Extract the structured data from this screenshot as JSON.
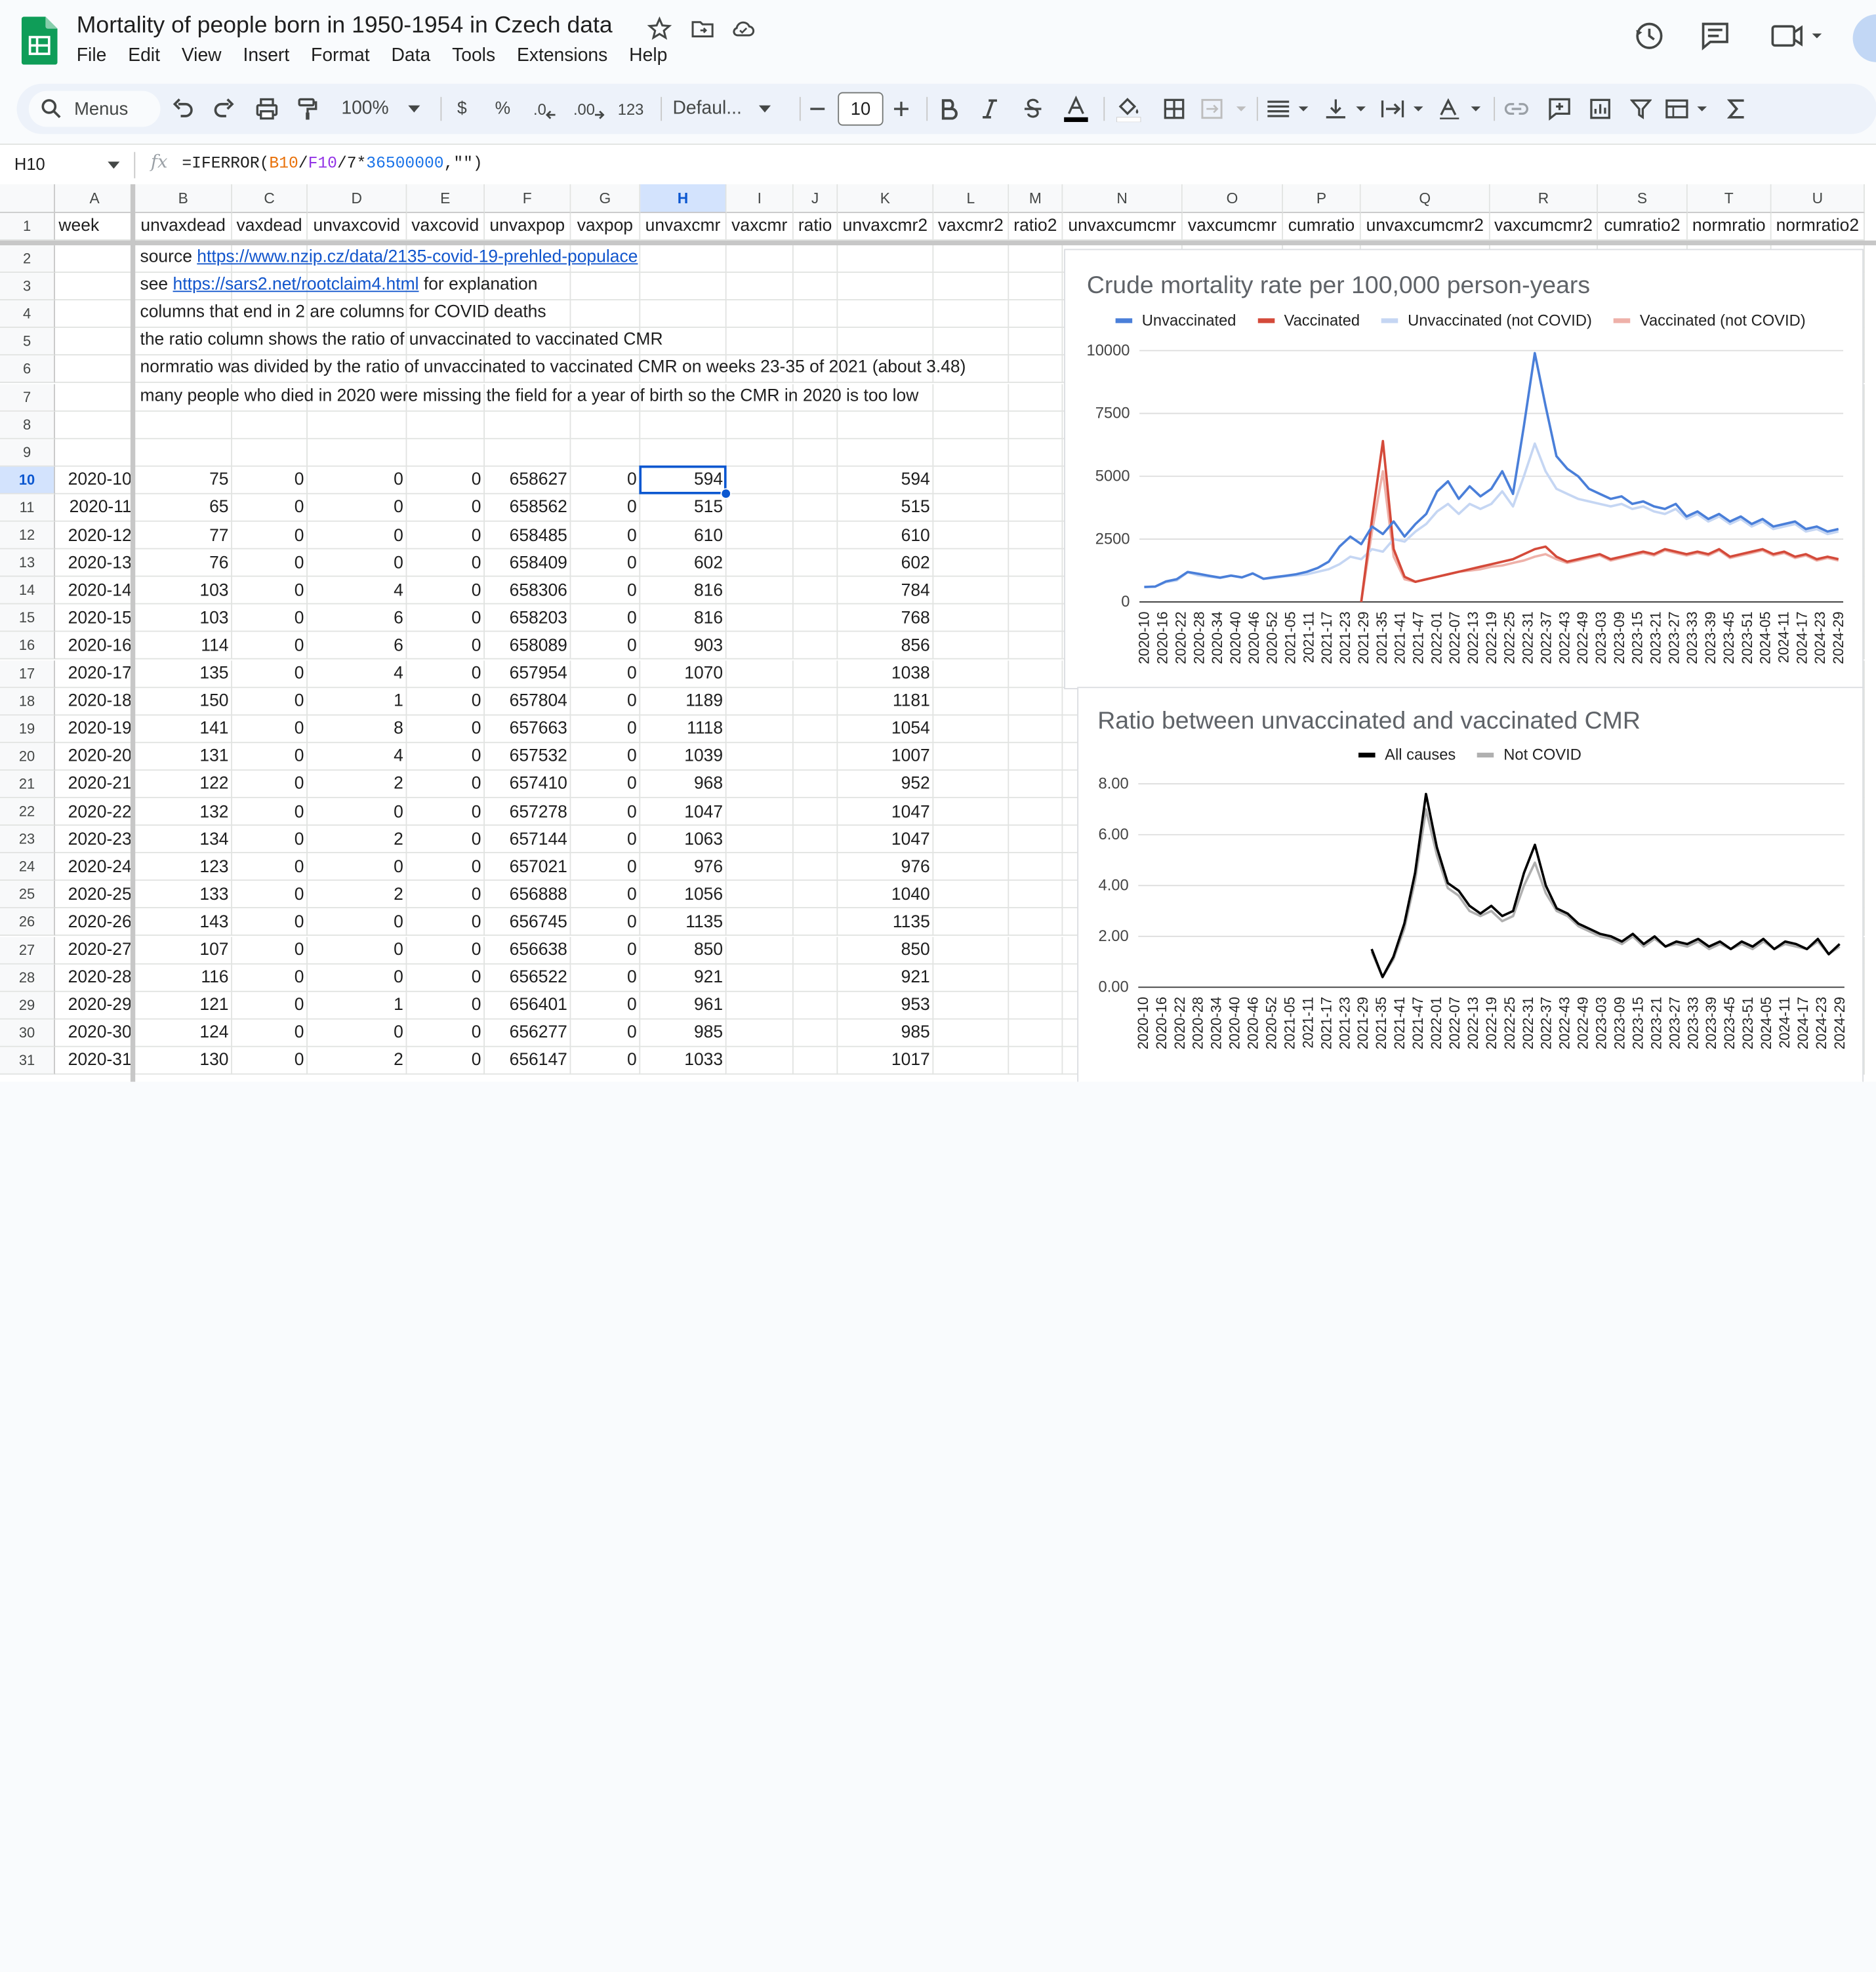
{
  "app": {
    "doc_title": "Mortality of people born in 1950-1954 in Czech data",
    "menu": [
      "File",
      "Edit",
      "View",
      "Insert",
      "Format",
      "Data",
      "Tools",
      "Extensions",
      "Help"
    ],
    "colors": {
      "sheets_green": "#0f9d58",
      "selection": "#0b57d0"
    }
  },
  "toolbar": {
    "menus_label": "Menus",
    "zoom": "100%",
    "currency": "$",
    "percent": "%",
    "dec_decrease": ".0",
    "dec_increase": ".00",
    "number_format": "123",
    "font": "Defaul...",
    "font_size": "10"
  },
  "formula_bar": {
    "cell_ref": "H10",
    "fx": "fx",
    "formula_parts": [
      "=IFERROR(",
      "B10",
      "/",
      "F10",
      "/7*",
      "36500000",
      ",\"\")"
    ]
  },
  "columns": [
    "A",
    "B",
    "C",
    "D",
    "E",
    "F",
    "G",
    "H",
    "I",
    "J",
    "K",
    "L",
    "M",
    "N",
    "O",
    "P",
    "Q",
    "R",
    "S",
    "T",
    "U"
  ],
  "header_row": [
    "week",
    "unvaxdead",
    "vaxdead",
    "unvaxcovid",
    "vaxcovid",
    "unvaxpop",
    "vaxpop",
    "unvaxcmr",
    "vaxcmr",
    "ratio",
    "unvaxcmr2",
    "vaxcmr2",
    "ratio2",
    "unvaxcumcmr",
    "vaxcumcmr",
    "cumratio",
    "unvaxcumcmr2",
    "vaxcumcmr2",
    "cumratio2",
    "normratio",
    "normratio2"
  ],
  "row_numbers": [
    "1",
    "2",
    "3",
    "4",
    "5",
    "6",
    "7",
    "8",
    "9",
    "10",
    "11",
    "12",
    "13",
    "14",
    "15",
    "16",
    "17",
    "18",
    "19",
    "20",
    "21",
    "22",
    "23",
    "24",
    "25",
    "26",
    "27",
    "28",
    "29",
    "30",
    "31"
  ],
  "notes": {
    "source_prefix": "source ",
    "source_link": "https://www.nzip.cz/data/2135-covid-19-prehled-populace",
    "see_prefix": "see ",
    "see_link": "https://sars2.net/rootclaim4.html",
    "see_suffix": " for explanation",
    "line3": "columns that end in 2 are columns for COVID deaths",
    "line4": "the ratio column shows the ratio of unvaccinated to vaccinated CMR",
    "line5": "normratio was divided by the ratio of unvaccinated to vaccinated CMR on weeks 23-35 of 2021 (about 3.48)",
    "line6": "many people who died in 2020 were missing the field for a year of birth so the CMR in 2020 is too low"
  },
  "data_rows": [
    [
      "2020-10",
      "75",
      "0",
      "0",
      "0",
      "658627",
      "0",
      "594",
      "594"
    ],
    [
      "2020-11",
      "65",
      "0",
      "0",
      "0",
      "658562",
      "0",
      "515",
      "515"
    ],
    [
      "2020-12",
      "77",
      "0",
      "0",
      "0",
      "658485",
      "0",
      "610",
      "610"
    ],
    [
      "2020-13",
      "76",
      "0",
      "0",
      "0",
      "658409",
      "0",
      "602",
      "602"
    ],
    [
      "2020-14",
      "103",
      "0",
      "4",
      "0",
      "658306",
      "0",
      "816",
      "784"
    ],
    [
      "2020-15",
      "103",
      "0",
      "6",
      "0",
      "658203",
      "0",
      "816",
      "768"
    ],
    [
      "2020-16",
      "114",
      "0",
      "6",
      "0",
      "658089",
      "0",
      "903",
      "856"
    ],
    [
      "2020-17",
      "135",
      "0",
      "4",
      "0",
      "657954",
      "0",
      "1070",
      "1038"
    ],
    [
      "2020-18",
      "150",
      "0",
      "1",
      "0",
      "657804",
      "0",
      "1189",
      "1181"
    ],
    [
      "2020-19",
      "141",
      "0",
      "8",
      "0",
      "657663",
      "0",
      "1118",
      "1054"
    ],
    [
      "2020-20",
      "131",
      "0",
      "4",
      "0",
      "657532",
      "0",
      "1039",
      "1007"
    ],
    [
      "2020-21",
      "122",
      "0",
      "2",
      "0",
      "657410",
      "0",
      "968",
      "952"
    ],
    [
      "2020-22",
      "132",
      "0",
      "0",
      "0",
      "657278",
      "0",
      "1047",
      "1047"
    ],
    [
      "2020-23",
      "134",
      "0",
      "2",
      "0",
      "657144",
      "0",
      "1063",
      "1047"
    ],
    [
      "2020-24",
      "123",
      "0",
      "0",
      "0",
      "657021",
      "0",
      "976",
      "976"
    ],
    [
      "2020-25",
      "133",
      "0",
      "2",
      "0",
      "656888",
      "0",
      "1056",
      "1040"
    ],
    [
      "2020-26",
      "143",
      "0",
      "0",
      "0",
      "656745",
      "0",
      "1135",
      "1135"
    ],
    [
      "2020-27",
      "107",
      "0",
      "0",
      "0",
      "656638",
      "0",
      "850",
      "850"
    ],
    [
      "2020-28",
      "116",
      "0",
      "0",
      "0",
      "656522",
      "0",
      "921",
      "921"
    ],
    [
      "2020-29",
      "121",
      "0",
      "1",
      "0",
      "656401",
      "0",
      "961",
      "953"
    ],
    [
      "2020-30",
      "124",
      "0",
      "0",
      "0",
      "656277",
      "0",
      "985",
      "985"
    ],
    [
      "2020-31",
      "130",
      "0",
      "2",
      "0",
      "656147",
      "0",
      "1033",
      "1017"
    ]
  ],
  "chart_data": [
    {
      "type": "line",
      "title": "Crude mortality rate per 100,000 person-years",
      "ylim": [
        0,
        10000
      ],
      "yticks": [
        "0",
        "2500",
        "5000",
        "7500",
        "10000"
      ],
      "xticks": [
        "2020-10",
        "2020-16",
        "2020-22",
        "2020-28",
        "2020-34",
        "2020-40",
        "2020-46",
        "2020-52",
        "2021-05",
        "2021-11",
        "2021-17",
        "2021-23",
        "2021-29",
        "2021-35",
        "2021-41",
        "2021-47",
        "2022-01",
        "2022-07",
        "2022-13",
        "2022-19",
        "2022-25",
        "2022-31",
        "2022-37",
        "2022-43",
        "2022-49",
        "2023-03",
        "2023-09",
        "2023-15",
        "2023-21",
        "2023-27",
        "2023-33",
        "2023-39",
        "2023-45",
        "2023-51",
        "2024-05",
        "2024-11",
        "2024-17",
        "2024-23",
        "2024-29"
      ],
      "legend_position": "top",
      "grid": true,
      "series": [
        {
          "name": "Unvaccinated",
          "color": "#4a7fd9",
          "values": [
            594,
            610,
            816,
            903,
            1189,
            1118,
            1039,
            968,
            1047,
            976,
            1135,
            921,
            985,
            1040,
            1100,
            1200,
            1350,
            1600,
            2200,
            2600,
            2300,
            3000,
            2700,
            3200,
            2600,
            3100,
            3500,
            4400,
            4800,
            4100,
            4600,
            4200,
            4500,
            5200,
            4300,
            7000,
            9900,
            7800,
            5800,
            5300,
            5000,
            4500,
            4300,
            4100,
            4200,
            3900,
            4000,
            3800,
            3700,
            3900,
            3400,
            3600,
            3300,
            3500,
            3200,
            3400,
            3100,
            3300,
            3000,
            3100,
            3200,
            2900,
            3000,
            2800,
            2900
          ]
        },
        {
          "name": "Vaccinated",
          "color": "#d44a3a",
          "values": [
            null,
            null,
            null,
            null,
            null,
            null,
            null,
            null,
            null,
            null,
            null,
            null,
            null,
            null,
            null,
            null,
            null,
            null,
            null,
            null,
            0,
            3300,
            6400,
            2100,
            1000,
            800,
            900,
            1000,
            1100,
            1200,
            1300,
            1400,
            1500,
            1600,
            1700,
            1900,
            2100,
            2200,
            1800,
            1600,
            1700,
            1800,
            1900,
            1700,
            1800,
            1900,
            2000,
            1900,
            2100,
            2000,
            1900,
            2000,
            1900,
            2100,
            1800,
            1900,
            2000,
            2100,
            1900,
            2000,
            1800,
            1900,
            1700,
            1800,
            1700
          ]
        },
        {
          "name": "Unvaccinated (not COVID)",
          "color": "#c5d6f3",
          "values": [
            594,
            610,
            784,
            856,
            1181,
            1054,
            1007,
            952,
            1047,
            976,
            1135,
            921,
            953,
            1017,
            1050,
            1100,
            1200,
            1300,
            1500,
            1800,
            1700,
            2100,
            2000,
            2500,
            2400,
            2800,
            3100,
            3600,
            3900,
            3500,
            3900,
            3700,
            3900,
            4400,
            3800,
            5000,
            6300,
            5200,
            4500,
            4300,
            4100,
            4000,
            3900,
            3800,
            3900,
            3700,
            3800,
            3600,
            3500,
            3700,
            3300,
            3500,
            3200,
            3400,
            3100,
            3300,
            3000,
            3200,
            2900,
            3000,
            3100,
            2800,
            2900,
            2700,
            2800
          ]
        },
        {
          "name": "Vaccinated (not COVID)",
          "color": "#eeb1a9",
          "values": [
            null,
            null,
            null,
            null,
            null,
            null,
            null,
            null,
            null,
            null,
            null,
            null,
            null,
            null,
            null,
            null,
            null,
            null,
            null,
            null,
            0,
            2800,
            5200,
            1800,
            900,
            800,
            900,
            1000,
            1100,
            1200,
            1250,
            1300,
            1400,
            1450,
            1550,
            1650,
            1800,
            1900,
            1700,
            1550,
            1650,
            1750,
            1850,
            1650,
            1750,
            1850,
            1950,
            1850,
            2050,
            1950,
            1850,
            1950,
            1850,
            2050,
            1750,
            1850,
            1950,
            2050,
            1850,
            1950,
            1750,
            1850,
            1650,
            1750,
            1650
          ]
        }
      ]
    },
    {
      "type": "line",
      "title": "Ratio between unvaccinated and vaccinated CMR",
      "ylim": [
        0,
        8
      ],
      "yticks": [
        "0.00",
        "2.00",
        "4.00",
        "6.00",
        "8.00"
      ],
      "xticks": [
        "2020-10",
        "2020-16",
        "2020-22",
        "2020-28",
        "2020-34",
        "2020-40",
        "2020-46",
        "2020-52",
        "2021-05",
        "2021-11",
        "2021-17",
        "2021-23",
        "2021-29",
        "2021-35",
        "2021-41",
        "2021-47",
        "2022-01",
        "2022-07",
        "2022-13",
        "2022-19",
        "2022-25",
        "2022-31",
        "2022-37",
        "2022-43",
        "2022-49",
        "2023-03",
        "2023-09",
        "2023-15",
        "2023-21",
        "2023-27",
        "2023-33",
        "2023-39",
        "2023-45",
        "2023-51",
        "2024-05",
        "2024-11",
        "2024-17",
        "2024-23",
        "2024-29"
      ],
      "legend_position": "top",
      "grid": true,
      "series": [
        {
          "name": "All causes",
          "color": "#000000",
          "values": [
            null,
            null,
            null,
            null,
            null,
            null,
            null,
            null,
            null,
            null,
            null,
            null,
            null,
            null,
            null,
            null,
            null,
            null,
            null,
            null,
            null,
            1.5,
            0.4,
            1.2,
            2.5,
            4.5,
            7.6,
            5.5,
            4.1,
            3.8,
            3.2,
            2.9,
            3.2,
            2.8,
            3.0,
            4.5,
            5.6,
            4.0,
            3.1,
            2.9,
            2.5,
            2.3,
            2.1,
            2.0,
            1.8,
            2.1,
            1.7,
            2.0,
            1.6,
            1.8,
            1.7,
            1.9,
            1.6,
            1.8,
            1.5,
            1.8,
            1.6,
            1.9,
            1.5,
            1.8,
            1.7,
            1.5,
            1.9,
            1.3,
            1.7
          ]
        },
        {
          "name": "Not COVID",
          "color": "#b0b0b0",
          "values": [
            null,
            null,
            null,
            null,
            null,
            null,
            null,
            null,
            null,
            null,
            null,
            null,
            null,
            null,
            null,
            null,
            null,
            null,
            null,
            null,
            null,
            1.4,
            0.4,
            1.1,
            2.3,
            4.2,
            7.0,
            5.2,
            3.9,
            3.6,
            3.0,
            2.8,
            3.0,
            2.6,
            2.8,
            4.0,
            4.9,
            3.7,
            3.0,
            2.8,
            2.4,
            2.2,
            2.0,
            1.9,
            1.7,
            2.0,
            1.6,
            1.9,
            1.6,
            1.7,
            1.6,
            1.8,
            1.5,
            1.7,
            1.5,
            1.7,
            1.5,
            1.8,
            1.5,
            1.7,
            1.6,
            1.5,
            1.8,
            1.3,
            1.6
          ]
        }
      ]
    }
  ]
}
